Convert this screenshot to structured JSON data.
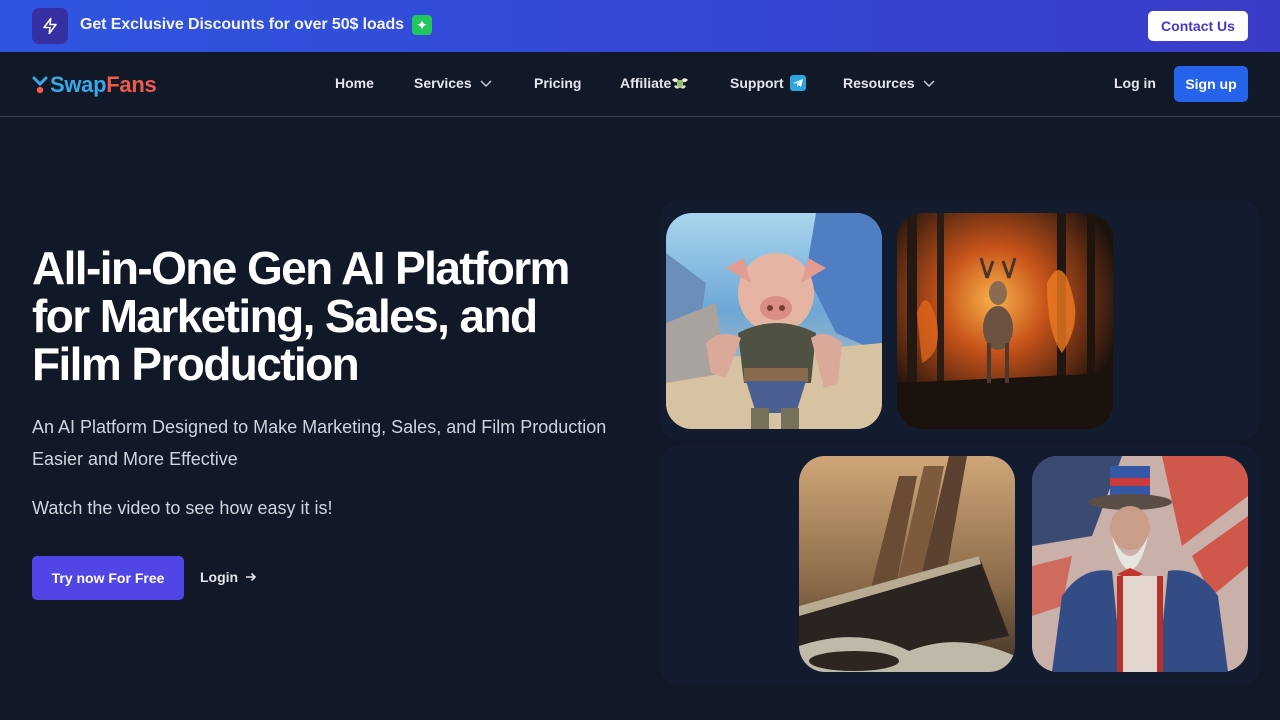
{
  "promo": {
    "icon": "lightning-bolt-icon",
    "text": "Get Exclusive Discounts for over 50$ loads",
    "emoji": "sparkles-icon",
    "contact_label": "Contact Us"
  },
  "nav": {
    "brand_part1": "Swap",
    "brand_part2": "Fans",
    "items": [
      {
        "label": "Home",
        "has_dropdown": false
      },
      {
        "label": "Services",
        "has_dropdown": true
      },
      {
        "label": "Pricing",
        "has_dropdown": false
      },
      {
        "label": "Affiliate",
        "has_dropdown": false,
        "icon": "money-with-wings-icon"
      },
      {
        "label": "Support",
        "has_dropdown": false,
        "icon": "telegram-icon"
      },
      {
        "label": "Resources",
        "has_dropdown": true
      }
    ],
    "login_label": "Log in",
    "signup_label": "Sign up"
  },
  "hero": {
    "title": "All-in-One Gen AI Platform for Marketing, Sales, and Film Production",
    "subtitle": "An AI Platform Designed to Make Marketing, Sales, and Film Production Easier and More Effective",
    "watch_text": "Watch the video to see how easy it is!",
    "cta_primary": "Try now For Free",
    "cta_secondary": "Login",
    "cta_secondary_icon": "arrow-right-icon"
  },
  "gallery": [
    {
      "name": "pig-warrior-image",
      "alt": "Anthropomorphic pig warrior in mountains"
    },
    {
      "name": "deer-fire-image",
      "alt": "Deer in burning forest"
    },
    {
      "name": "sinking-ship-image",
      "alt": "Sinking ocean liner with lifeboats"
    },
    {
      "name": "uncle-sam-image",
      "alt": "Muscular Uncle Sam with American flag"
    }
  ],
  "colors": {
    "banner_start": "#2f55e0",
    "banner_end": "#3b3bc9",
    "background": "#111827",
    "primary_button": "#4f46e5",
    "signup_button": "#2563eb",
    "brand_blue": "#38a8e6",
    "brand_red": "#ef5a4c"
  }
}
